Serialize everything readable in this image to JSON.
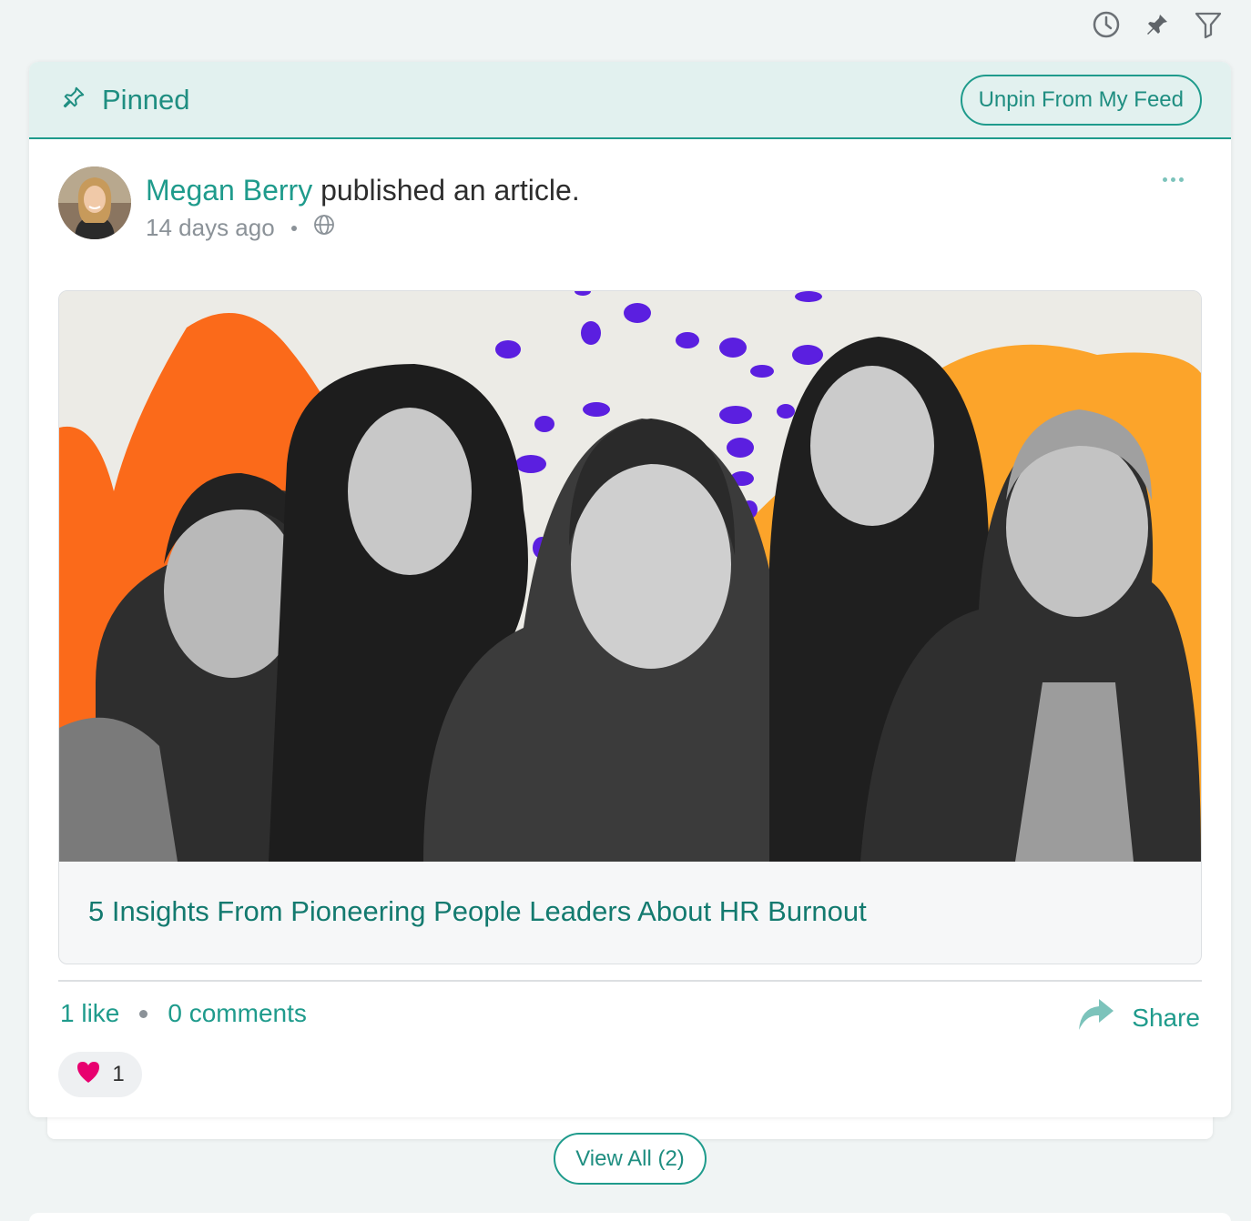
{
  "toolbar": {
    "icons": [
      "clock-icon",
      "pin-icon",
      "filter-icon"
    ]
  },
  "pinned": {
    "label": "Pinned",
    "unpin_label": "Unpin From My Feed"
  },
  "post": {
    "author": "Megan Berry",
    "action": " published an article.",
    "timestamp": "14 days ago",
    "visibility_icon": "globe-icon",
    "article_title": "5 Insights From Pioneering People Leaders About HR Burnout",
    "likes": "1 like",
    "comments": "0 comments",
    "share_label": "Share",
    "reaction_count": "1"
  },
  "view_all_label": "View All (2)",
  "colors": {
    "accent": "#1f9b8c",
    "pinned_bg": "#e2f1ef",
    "heart": "#e8006f",
    "orange": "#f97316",
    "purple": "#5b1fe0"
  }
}
